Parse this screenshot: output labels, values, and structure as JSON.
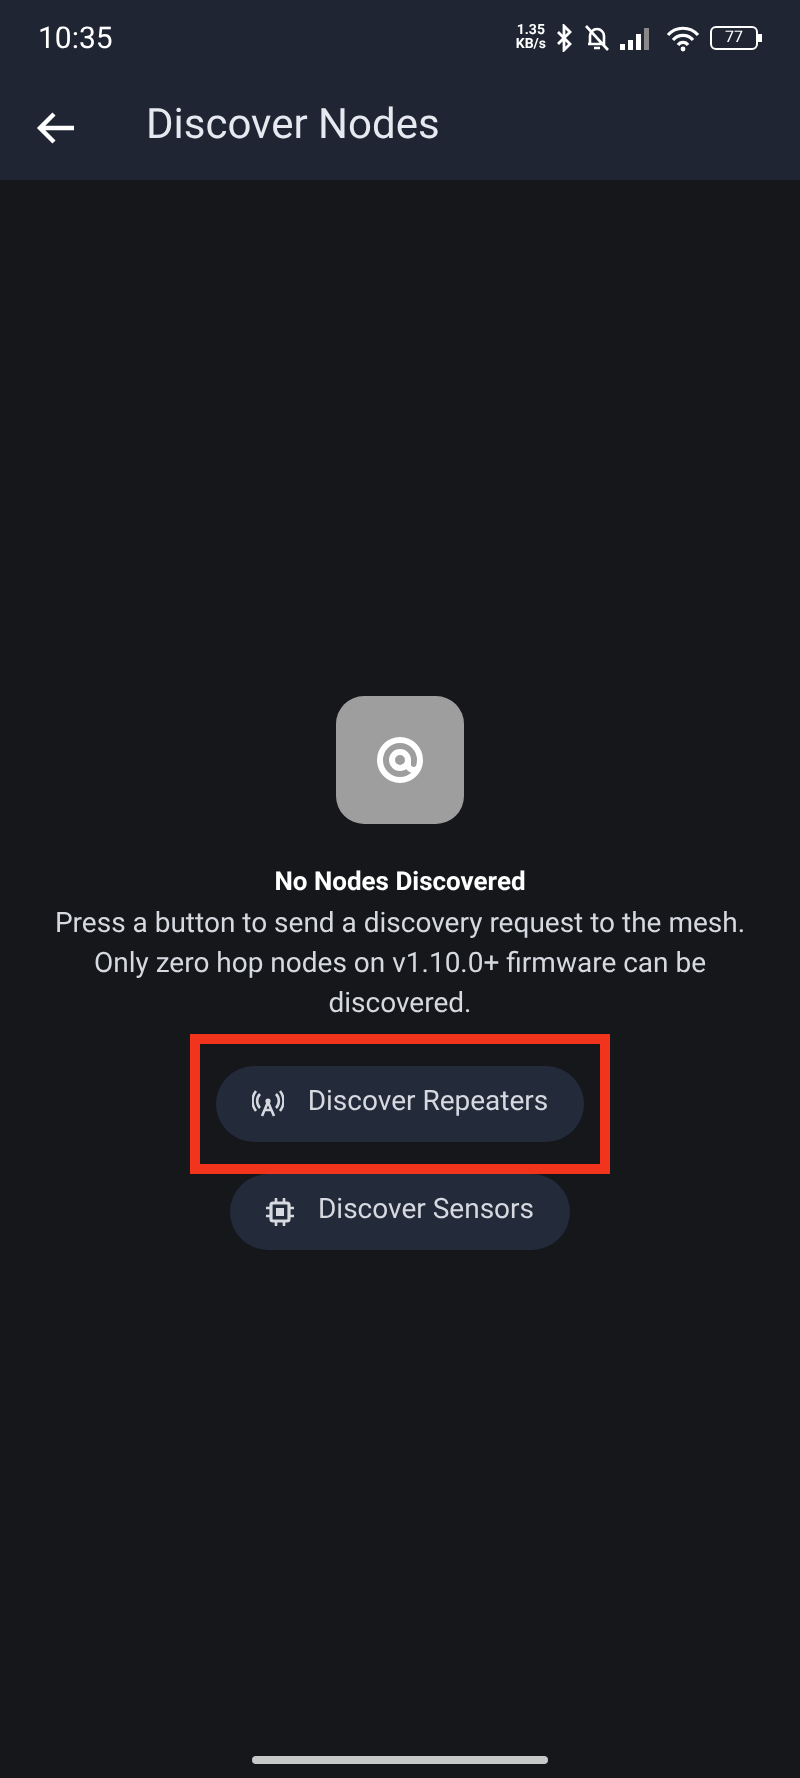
{
  "status_bar": {
    "time": "10:35",
    "net_speed_value": "1.35",
    "net_speed_unit": "KB/s",
    "battery": "77"
  },
  "app_bar": {
    "title": "Discover Nodes"
  },
  "empty_state": {
    "title": "No Nodes Discovered",
    "message": "Press a button to send a discovery request to the mesh. Only zero hop nodes on v1.10.0+ firmware can be discovered."
  },
  "buttons": [
    {
      "label": "Discover Repeaters",
      "kind": "antenna",
      "highlighted": true
    },
    {
      "label": "Discover Sensors",
      "kind": "chip",
      "highlighted": false
    }
  ]
}
